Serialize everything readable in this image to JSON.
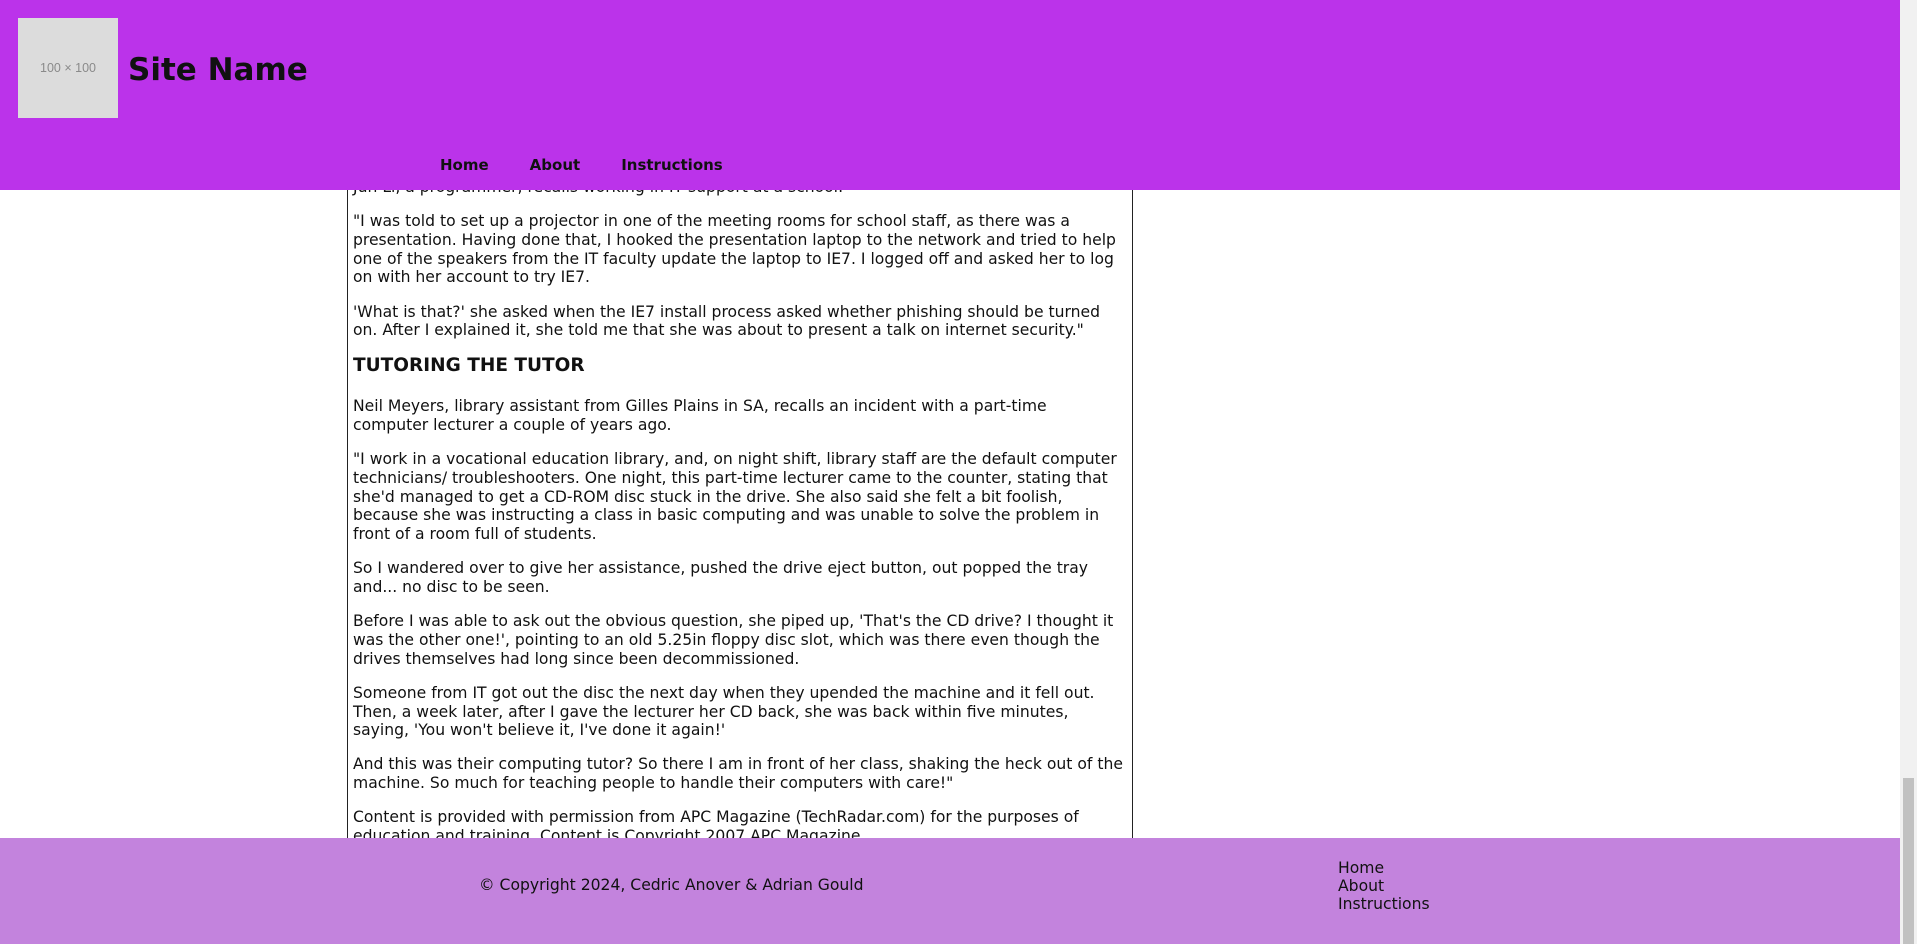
{
  "header": {
    "logo_text": "100 × 100",
    "site_name": "Site Name",
    "nav": [
      "Home",
      "About",
      "Instructions"
    ]
  },
  "article": {
    "clipped_line": "Jun Li, a programmer, recalls working in IT support at a school:",
    "p1": "\"I was told to set up a projector in one of the meeting rooms for school staff, as there was a presentation. Having done that, I hooked the presentation laptop to the network and tried to help one of the speakers from the IT faculty update the laptop to IE7. I logged off and asked her to log on with her account to try IE7.",
    "p2": "'What is that?' she asked when the IE7 install process asked whether phishing should be turned on. After I explained it, she told me that she was about to present a talk on internet security.\"",
    "heading": "TUTORING THE TUTOR",
    "p3": "Neil Meyers, library assistant from Gilles Plains in SA, recalls an incident with a part-time computer lecturer a couple of years ago.",
    "p4": "\"I work in a vocational education library, and, on night shift, library staff are the default computer technicians/ troubleshooters. One night, this part-time lecturer came to the counter, stating that she'd managed to get a CD-ROM disc stuck in the drive. She also said she felt a bit foolish, because she was instructing a class in basic computing and was unable to solve the problem in front of a room full of students.",
    "p5": "So I wandered over to give her assistance, pushed the drive eject button, out popped the tray and... no disc to be seen.",
    "p6": "Before I was able to ask out the obvious question, she piped up, 'That's the CD drive? I thought it was the other one!', pointing to an old 5.25in floppy disc slot, which was there even though the drives themselves had long since been decommissioned.",
    "p7": "Someone from IT got out the disc the next day when they upended the machine and it fell out. Then, a week later, after I gave the lecturer her CD back, she was back within five minutes, saying, 'You won't believe it, I've done it again!'",
    "p8": "And this was their computing tutor? So there I am in front of her class, shaking the heck out of the machine. So much for teaching people to handle their computers with care!\"",
    "p9": "Content is provided with permission from APC Magazine (TechRadar.com) for the purposes of education and training. Content is Copyright 2007 APC Magazine."
  },
  "footer": {
    "copyright": "© Copyright 2024, Cedric Anover & Adrian Gould",
    "links": [
      "Home",
      "About",
      "Instructions"
    ]
  },
  "colors": {
    "header_bg": "#bb33ea",
    "footer_bg": "#c383dd"
  }
}
